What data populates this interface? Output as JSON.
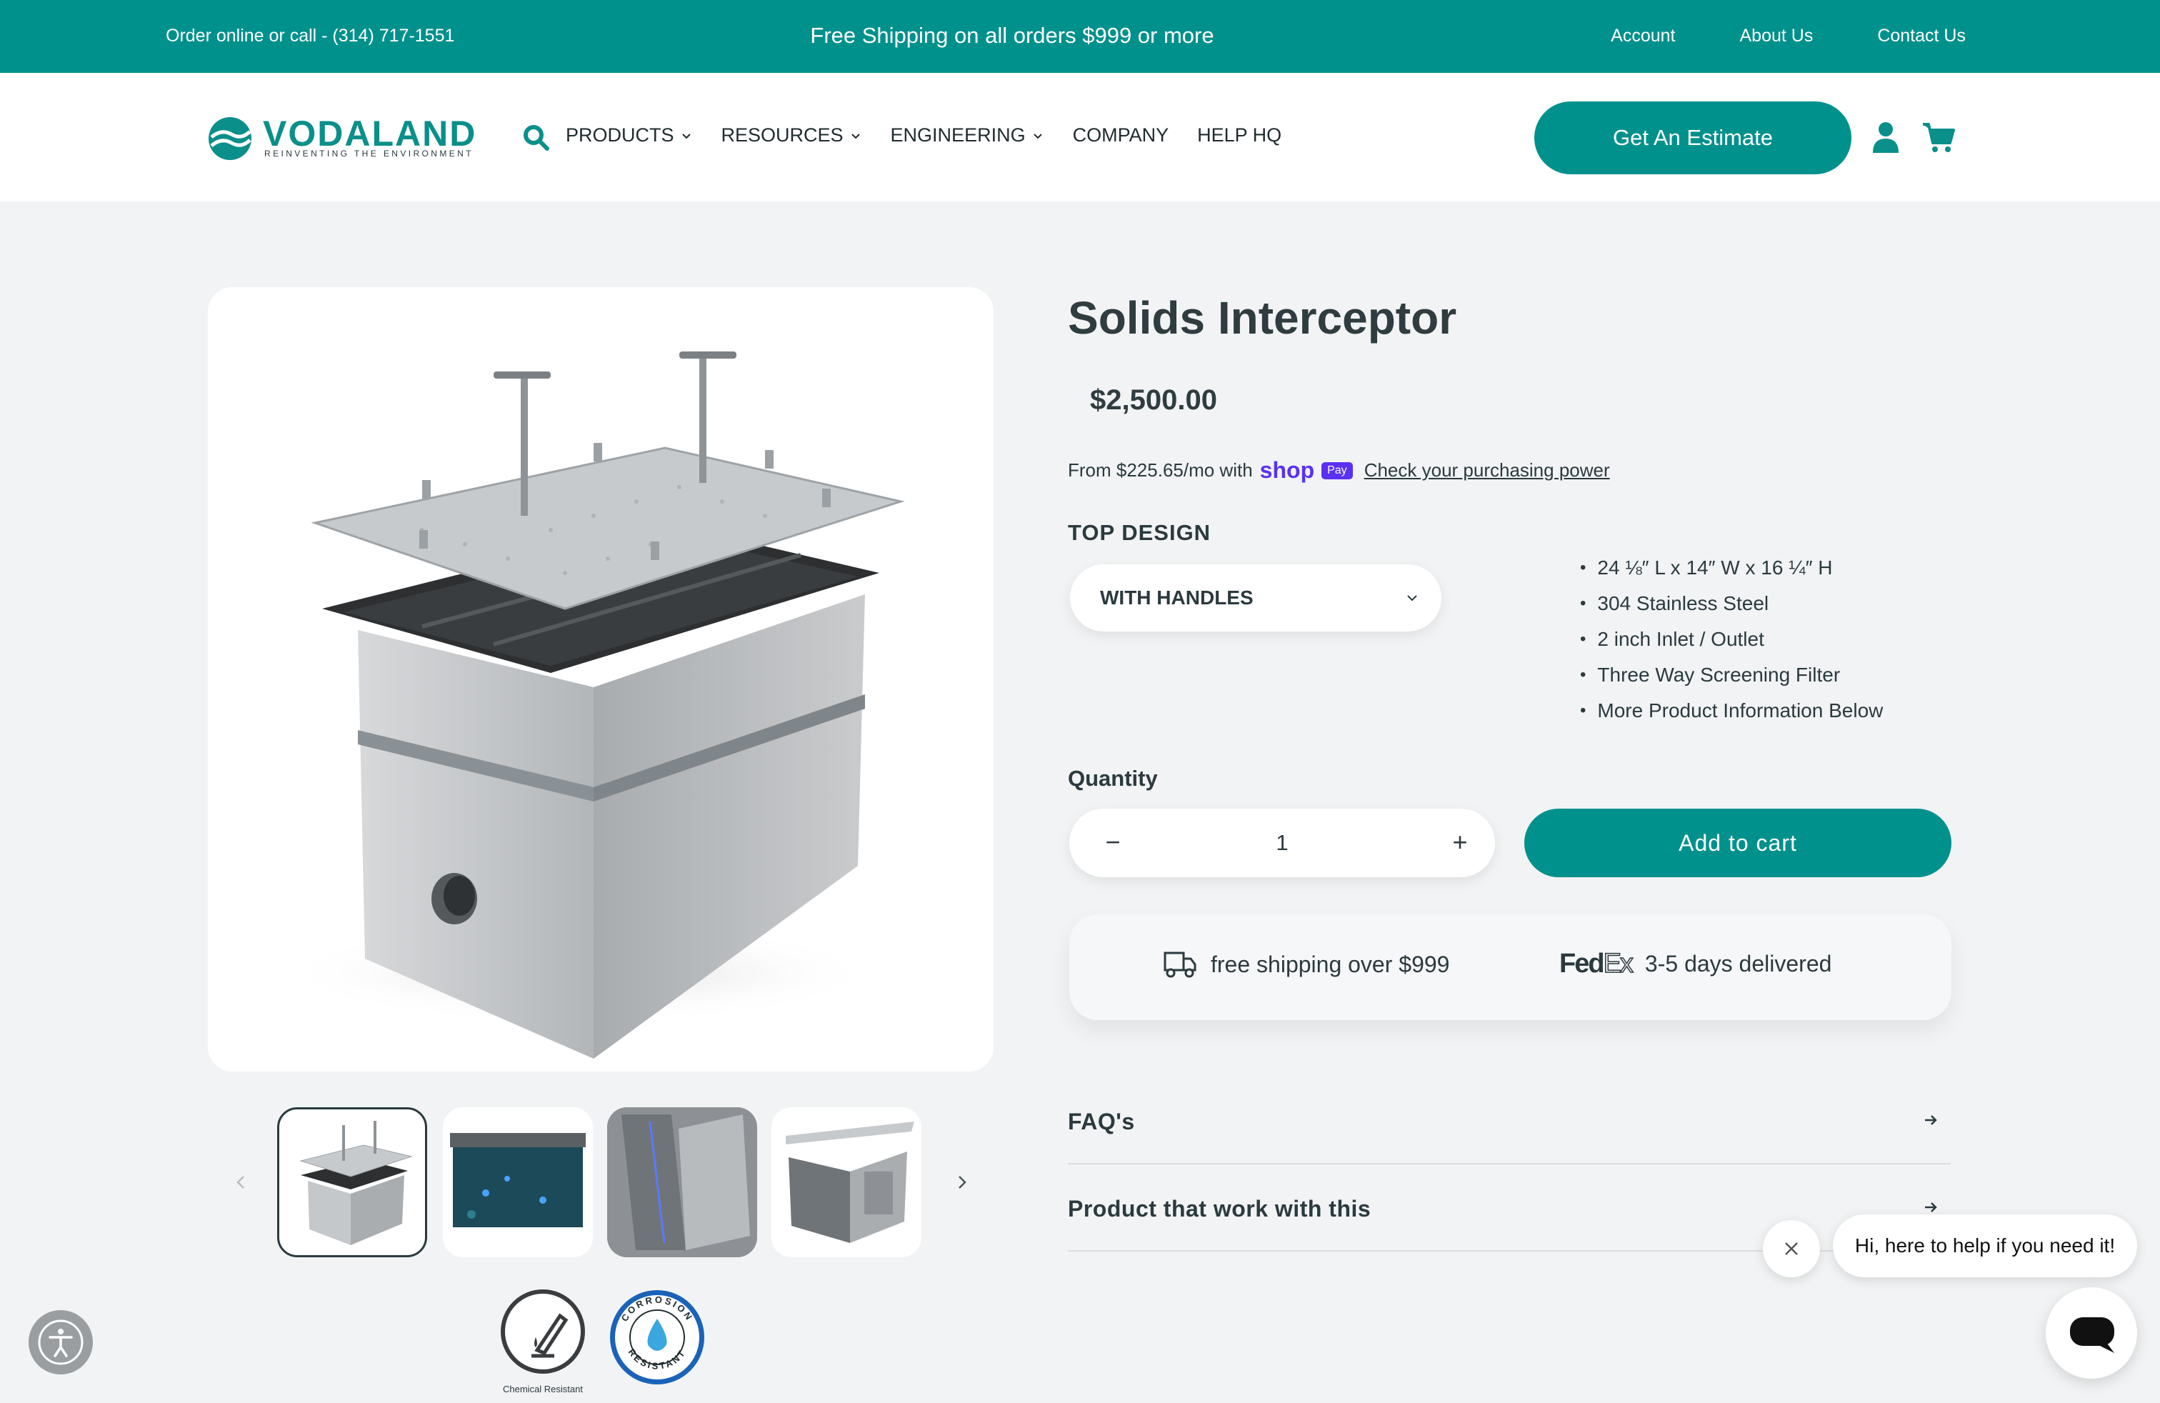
{
  "announcement": {
    "contact": "Order online or call - (314) 717-1551",
    "promo": "Free Shipping on all orders $999 or more",
    "links": [
      "Account",
      "About Us",
      "Contact Us"
    ]
  },
  "header": {
    "logo_name": "VODALAND",
    "logo_tagline": "REINVENTING THE ENVIRONMENT",
    "nav": [
      {
        "label": "PRODUCTS",
        "dropdown": true
      },
      {
        "label": "RESOURCES",
        "dropdown": true
      },
      {
        "label": "ENGINEERING",
        "dropdown": true
      },
      {
        "label": "COMPANY",
        "dropdown": false
      },
      {
        "label": "HELP HQ",
        "dropdown": false
      }
    ],
    "estimate_label": "Get An Estimate",
    "icons": [
      "search-icon",
      "user-icon",
      "cart-icon"
    ]
  },
  "product": {
    "title": "Solids Interceptor",
    "price": "$2,500.00",
    "installments_prefix": "From $225.65/mo with",
    "shop_word": "shop",
    "shop_pay_badge": "Pay",
    "installments_link": "Check your purchasing power",
    "top_design_label": "TOP DESIGN",
    "top_design_value": "WITH HANDLES",
    "features": [
      "24 ⅛″ L x 14″ W x 16 ¼″ H",
      "304 Stainless Steel",
      "2 inch Inlet / Outlet",
      "Three Way Screening Filter",
      "More Product Information Below"
    ],
    "quantity_label": "Quantity",
    "quantity_value": "1",
    "minus_symbol": "−",
    "plus_symbol": "+",
    "add_to_cart": "Add to cart",
    "shipping_text": "free shipping over $999",
    "fedex_fed": "Fed",
    "fedex_ex": "Ex",
    "delivery_text": "3-5 days delivered",
    "accordions": [
      "FAQ's",
      "Product that work with this"
    ]
  },
  "badges": {
    "chemical": "Chemical Resistant",
    "corrosion": "CORROSION RESISTANT"
  },
  "chat": {
    "message": "Hi, here to help if you need it!"
  },
  "colors": {
    "brand_teal": "#00918c",
    "background": "#f1f3f4",
    "text": "#2b3a3f",
    "shop_pay": "#5a31f4"
  }
}
